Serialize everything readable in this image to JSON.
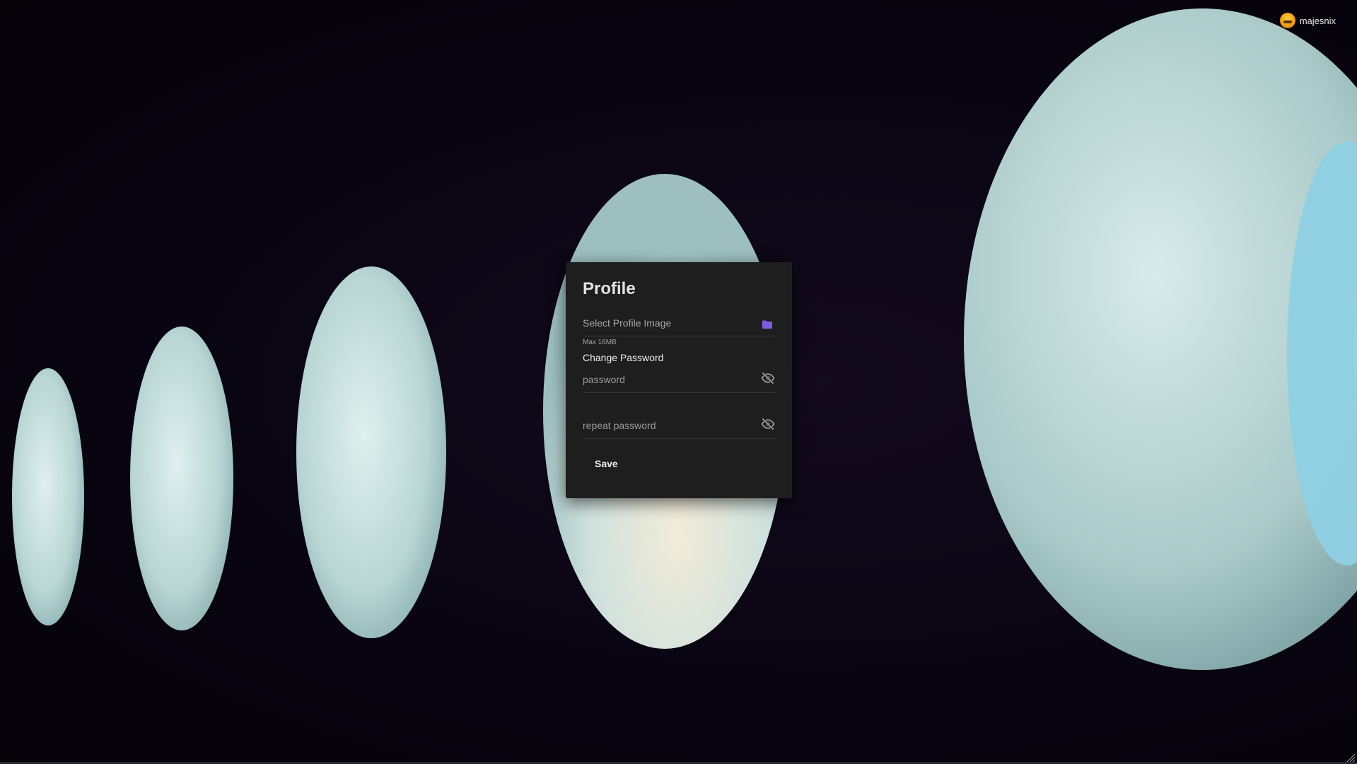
{
  "user": {
    "name": "majesnix"
  },
  "profile_card": {
    "title": "Profile",
    "profile_image": {
      "label": "Select Profile Image",
      "hint": "Max 16MB",
      "icon": "folder-icon",
      "icon_color": "#7c5ce0"
    },
    "change_password": {
      "label": "Change Password",
      "password": {
        "placeholder": "password",
        "value": "",
        "icon": "eye-off-icon"
      },
      "repeat_password": {
        "placeholder": "repeat password",
        "value": "",
        "icon": "eye-off-icon"
      }
    },
    "save_label": "Save"
  },
  "colors": {
    "card_background": "#1e1e1f",
    "accent": "#7c5ce0",
    "page_background": "#0c0510"
  }
}
